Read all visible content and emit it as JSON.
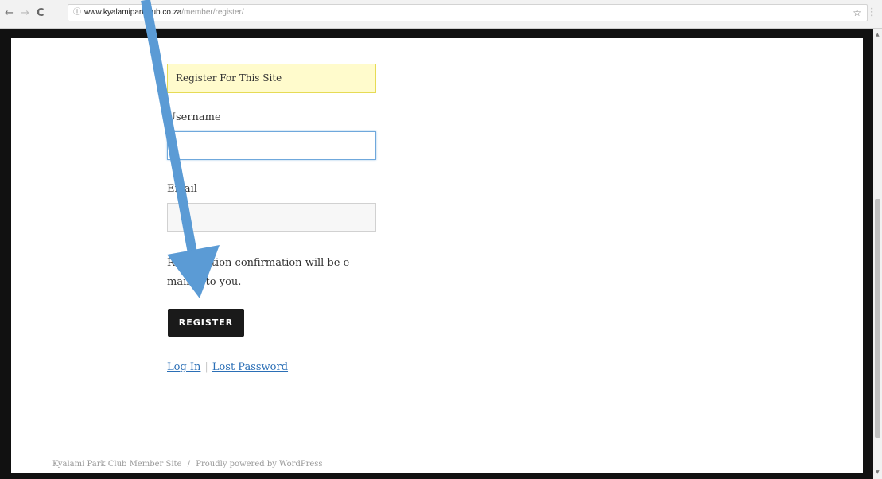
{
  "browser": {
    "back_icon": "←",
    "forward_icon": "→",
    "reload_icon": "C",
    "info_icon": "ⓘ",
    "url_host": "www.kyalamiparkclub.co.za",
    "url_path": "/member/register/",
    "star_icon": "☆",
    "menu_icon": "⋮"
  },
  "form": {
    "notice": "Register For This Site",
    "username_label": "Username",
    "username_value": "",
    "email_label": "Email",
    "email_value": "",
    "confirmation_note": "Registration confirmation will be e-mailed to you.",
    "register_button": "REGISTER",
    "login_link": "Log In",
    "separator": "|",
    "lost_password_link": "Lost Password"
  },
  "footer": {
    "site_name": "Kyalami Park Club Member Site",
    "separator": "/",
    "powered_by": "Proudly powered by WordPress"
  },
  "annotation": {
    "arrow_color": "#5b9bd5",
    "arrow_target": "register-button"
  }
}
